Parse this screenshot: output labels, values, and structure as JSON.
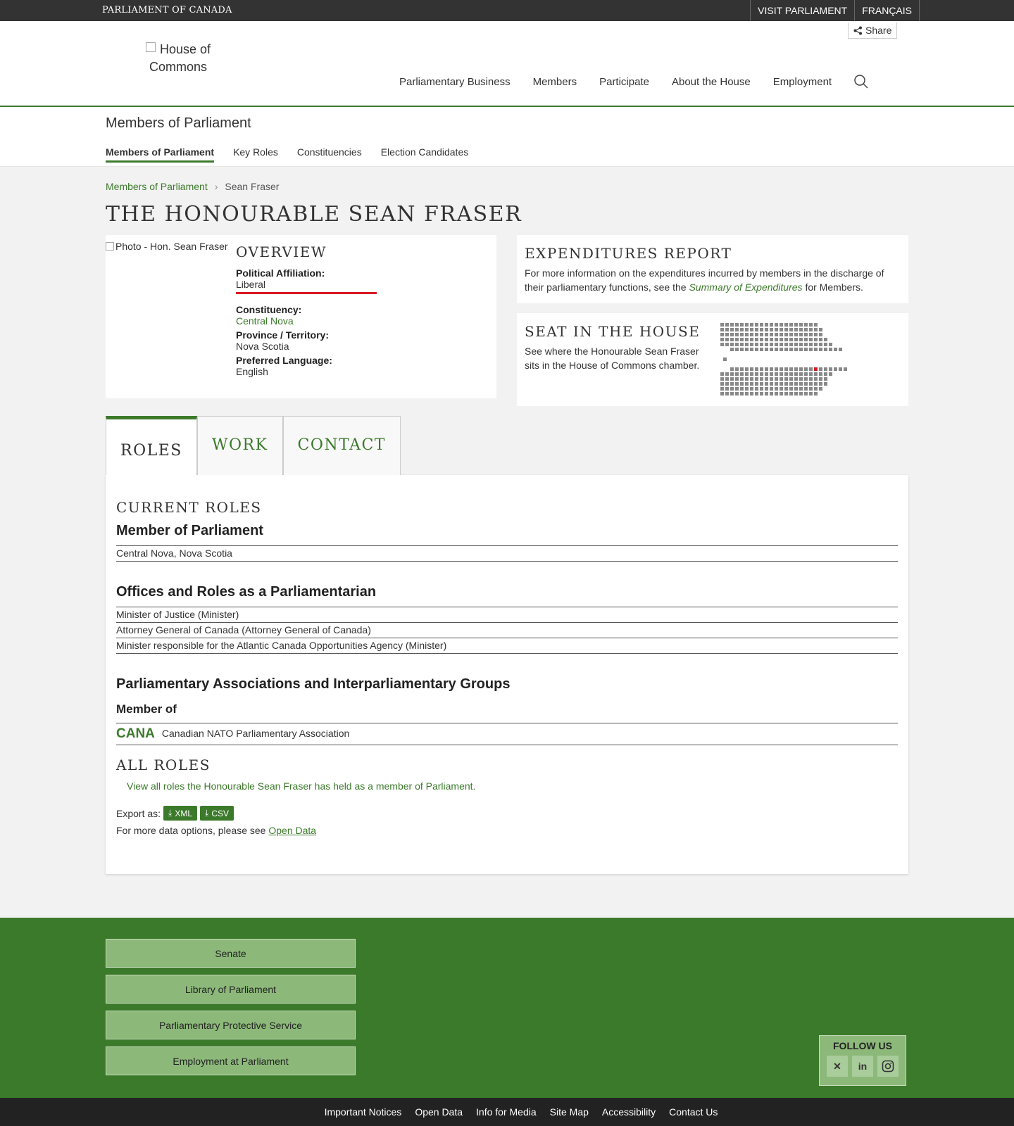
{
  "topbar": {
    "brand": "PARLIAMENT OF CANADA",
    "links": [
      "VISIT PARLIAMENT",
      "FRANÇAIS"
    ]
  },
  "header": {
    "share": "Share",
    "logo_alt": "House of Commons",
    "nav": [
      "Parliamentary Business",
      "Members",
      "Participate",
      "About the House",
      "Employment"
    ]
  },
  "section": {
    "title": "Members of Parliament",
    "tabs": [
      "Members of Parliament",
      "Key Roles",
      "Constituencies",
      "Election Candidates"
    ]
  },
  "breadcrumb": {
    "parent": "Members of Parliament",
    "current": "Sean Fraser"
  },
  "member": {
    "title": "THE HONOURABLE SEAN FRASER",
    "photo_alt": "Photo - Hon. Sean Fraser"
  },
  "overview": {
    "heading": "OVERVIEW",
    "affiliation_label": "Political Affiliation:",
    "affiliation": "Liberal",
    "party_color": "#d71920",
    "constituency_label": "Constituency:",
    "constituency": "Central Nova",
    "province_label": "Province / Territory:",
    "province": "Nova Scotia",
    "language_label": "Preferred Language:",
    "language": "English"
  },
  "expenditures": {
    "heading": "EXPENDITURES REPORT",
    "text_before": "For more information on the expenditures incurred by members in the discharge of their parliamentary functions, see the",
    "link": "Summary of Expenditures",
    "text_after": "for Members."
  },
  "seat": {
    "heading": "SEAT IN THE HOUSE",
    "text": "See where the Honourable Sean Fraser sits in the House of Commons chamber."
  },
  "tabs": [
    "ROLES",
    "WORK",
    "CONTACT"
  ],
  "roles": {
    "current_heading": "CURRENT ROLES",
    "mp_heading": "Member of Parliament",
    "mp_items": [
      "Central Nova, Nova Scotia"
    ],
    "offices_heading": "Offices and Roles as a Parliamentarian",
    "offices_items": [
      "Minister of Justice (Minister)",
      "Attorney General of Canada (Attorney General of Canada)",
      "Minister responsible for the Atlantic Canada Opportunities Agency (Minister)"
    ],
    "assoc_heading": "Parliamentary Associations and Interparliamentary Groups",
    "member_of": "Member of",
    "assoc_abbr": "CANA",
    "assoc_name": "Canadian NATO Parliamentary Association",
    "all_heading": "ALL ROLES",
    "all_link": "View all roles the Honourable Sean Fraser has held as a member of Parliament.",
    "export_label": "Export as:",
    "export_xml": "XML",
    "export_csv": "CSV",
    "more_text": "For more data options, please see",
    "more_link": "Open Data"
  },
  "footer": {
    "buttons": [
      "Senate",
      "Library of Parliament",
      "Parliamentary Protective Service",
      "Employment at Parliament"
    ],
    "follow": "FOLLOW US",
    "social": [
      "x-icon",
      "linkedin-icon",
      "instagram-icon"
    ],
    "bottom_links": [
      "Important Notices",
      "Open Data",
      "Info for Media",
      "Site Map",
      "Accessibility",
      "Contact Us"
    ]
  },
  "colors": {
    "accent": "#3c7a2b",
    "footer": "#3c7a2b",
    "dark": "#333333"
  }
}
